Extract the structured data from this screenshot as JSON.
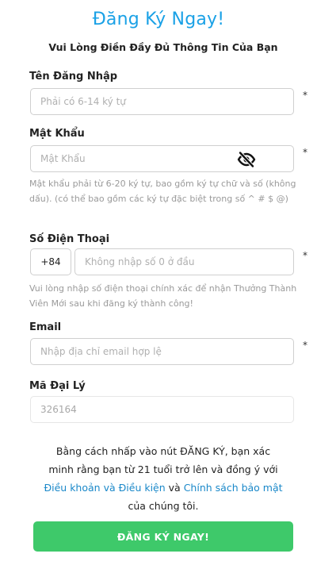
{
  "header": {
    "title": "Đăng Ký Ngay!",
    "subtitle": "Vui Lòng Điền Đầy Đủ Thông Tin Của Bạn"
  },
  "form": {
    "username": {
      "label": "Tên Đăng Nhập",
      "placeholder": "Phải có 6-14 ký tự",
      "required_mark": "*"
    },
    "password": {
      "label": "Mật Khẩu",
      "placeholder": "Mật Khẩu",
      "required_mark": "*",
      "toggle_icon": "eye-slash-icon",
      "hint": "Mật khẩu phải từ 6-20 ký tự, bao gồm ký tự chữ và số (không dấu). (có thể bao gồm các ký tự đặc biệt trong số ^ # $ @)"
    },
    "phone": {
      "label": "Số Điện Thoại",
      "prefix": "+84",
      "placeholder": "Không nhập số 0 ở đầu",
      "required_mark": "*",
      "hint": "Vui lòng nhập số điện thoại chính xác để nhận Thưởng Thành Viên Mới sau khi đăng ký thành công!"
    },
    "email": {
      "label": "Email",
      "placeholder": "Nhập địa chỉ email hợp lệ",
      "required_mark": "*"
    },
    "agent_code": {
      "label": "Mã Đại Lý",
      "value": "326164"
    }
  },
  "terms": {
    "line1": "Bằng cách nhấp vào nút ĐĂNG KÝ, bạn xác",
    "line2": "minh rằng bạn từ 21 tuổi trở lên và đồng ý với",
    "terms_link": "Điều khoản và Điều kiện",
    "conjunction": "và",
    "privacy_link": "Chính sách bảo mật",
    "line4": "của chúng tôi."
  },
  "submit": {
    "label": "ĐĂNG KÝ NGAY!",
    "color": "#3ec96a"
  },
  "colors": {
    "accent": "#1aa1e6",
    "link": "#1a88c9"
  }
}
